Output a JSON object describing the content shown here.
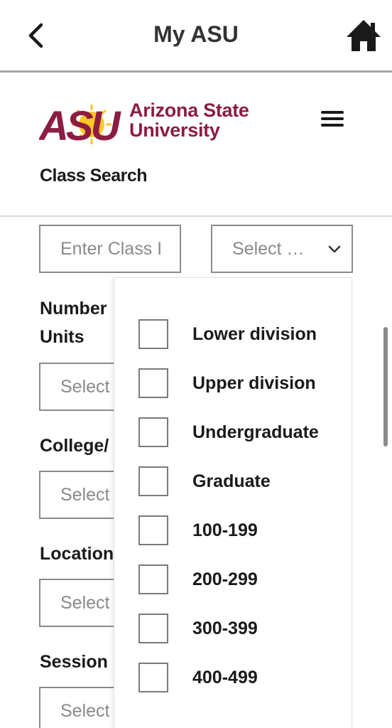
{
  "appbar": {
    "title": "My ASU",
    "back_icon": "chevron-left-icon",
    "home_icon": "home-icon"
  },
  "header": {
    "logo_text": "ASU",
    "wordmark_line1": "Arizona State",
    "wordmark_line2": "University",
    "menu_icon": "hamburger-menu-icon",
    "page_title": "Class Search",
    "brand_maroon": "#8c1d40",
    "brand_gold": "#ffc627"
  },
  "search": {
    "class_input_placeholder": "Enter Class I",
    "level_select_value": "Select …"
  },
  "filters": [
    {
      "label_line1": "Number",
      "label_line2": "Units",
      "value": "Select"
    },
    {
      "label_line1": "College/",
      "value": "Select"
    },
    {
      "label_line1": "Location",
      "value": "Select"
    },
    {
      "label_line1": "Session",
      "value": "Select"
    }
  ],
  "dropdown": {
    "options": [
      {
        "label": "Lower division",
        "checked": false
      },
      {
        "label": "Upper division",
        "checked": false
      },
      {
        "label": "Undergraduate",
        "checked": false
      },
      {
        "label": "Graduate",
        "checked": false
      },
      {
        "label": "100-199",
        "checked": false
      },
      {
        "label": "200-299",
        "checked": false
      },
      {
        "label": "300-399",
        "checked": false
      },
      {
        "label": "400-499",
        "checked": false
      }
    ]
  }
}
